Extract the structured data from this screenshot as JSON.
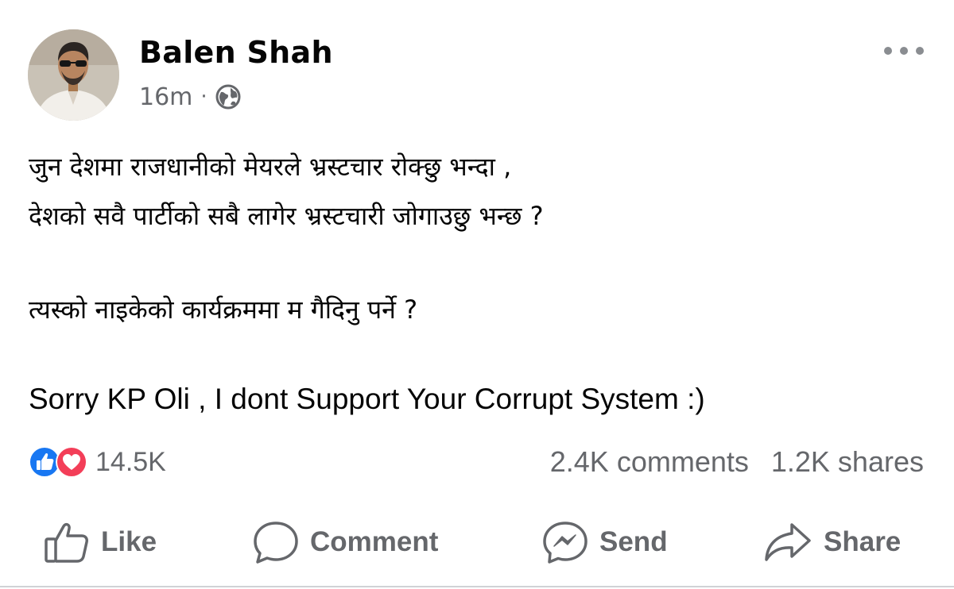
{
  "post": {
    "author": "Balen Shah",
    "time": "16m",
    "separator": "·",
    "privacy_icon": "globe-icon",
    "more_icon": "more-options-icon",
    "content": {
      "para1_line1": "जुन देशमा राजधानीको मेयरले भ्रस्टचार रोक्छु भन्दा ,",
      "para1_line2": "देशको सवै पार्टीको सबै लागेर भ्रस्टचारी जोगाउछु भन्छ ?",
      "para2": "त्यस्को नाइकेको कार्यक्रममा म गैदिनु पर्ने ?",
      "para3": "Sorry KP Oli , I dont Support Your Corrupt System :)"
    },
    "reactions": {
      "icons": [
        "like-reaction-icon",
        "love-reaction-icon"
      ],
      "count": "14.5K"
    },
    "comments": "2.4K comments",
    "shares": "1.2K shares",
    "actions": {
      "like": "Like",
      "comment": "Comment",
      "send": "Send",
      "share": "Share"
    },
    "colors": {
      "like_blue": "#1877f2",
      "love_red": "#f33e58",
      "muted_text": "#65676b"
    }
  }
}
